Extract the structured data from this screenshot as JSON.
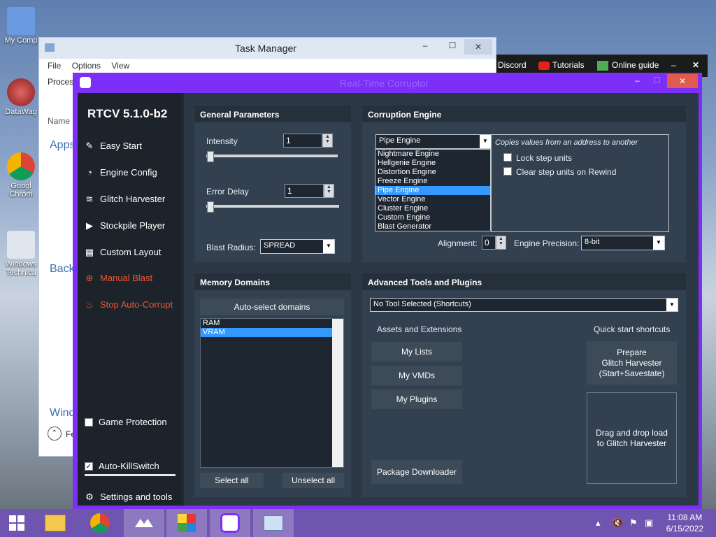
{
  "desktop": {
    "icons": [
      {
        "label": "My Comp",
        "color": "#6a9be0"
      },
      {
        "label": "DataWag",
        "color": "#d9534f"
      },
      {
        "label": "Googl Chrom",
        "color": "#4285f4"
      },
      {
        "label": "Windows Technica",
        "color": "#8ba3c4"
      }
    ]
  },
  "black_strip": {
    "discord": "Discord",
    "tutorials": "Tutorials",
    "online_guide": "Online guide",
    "close": "✕",
    "minimize": "–"
  },
  "task_manager": {
    "title": "Task Manager",
    "menu": [
      "File",
      "Options",
      "View"
    ],
    "tab_processes": "Proces",
    "col_name": "Name",
    "group_apps": "Apps",
    "group_background": "Back",
    "group_windows": "Wind",
    "fewer": "Fe"
  },
  "rtc": {
    "title": "Real-Time Corruptor",
    "version": "RTCV 5.1.0-b2",
    "sidebar": {
      "easy_start": "Easy Start",
      "engine_config": "Engine Config",
      "glitch_harvester": "Glitch Harvester",
      "stockpile_player": "Stockpile Player",
      "custom_layout": "Custom Layout",
      "manual_blast": "Manual Blast",
      "stop_auto_corrupt": "Stop Auto-Corrupt",
      "game_protection": "Game Protection",
      "auto_killswitch": "Auto-KillSwitch",
      "settings_tools": "Settings and tools"
    },
    "general_params": {
      "header": "General Parameters",
      "intensity_label": "Intensity",
      "intensity_value": "1",
      "error_delay_label": "Error Delay",
      "error_delay_value": "1",
      "blast_radius_label": "Blast Radius:",
      "blast_radius_value": "SPREAD"
    },
    "corruption_engine": {
      "header": "Corruption Engine",
      "selected": "Pipe Engine",
      "description": "Copies values from an address to another",
      "options": [
        "Nightmare Engine",
        "Hellgenie Engine",
        "Distortion Engine",
        "Freeze Engine",
        "Pipe Engine",
        "Vector Engine",
        "Cluster Engine",
        "Custom Engine",
        "Blast Generator"
      ],
      "selected_index": 4,
      "lock_step": "Lock step units",
      "clear_step": "Clear step units on Rewind",
      "alignment_label": "Alignment:",
      "alignment_value": "0",
      "precision_label": "Engine Precision:",
      "precision_value": "8-bit"
    },
    "memory_domains": {
      "header": "Memory Domains",
      "auto_select": "Auto-select domains",
      "items": [
        "RAM",
        "VRAM"
      ],
      "selected_index": 1,
      "select_all": "Select all",
      "unselect_all": "Unselect all"
    },
    "advanced": {
      "header": "Advanced Tools and Plugins",
      "tool_select": "No Tool Selected (Shortcuts)",
      "assets_header": "Assets and Extensions",
      "my_lists": "My Lists",
      "my_vmds": "My VMDs",
      "my_plugins": "My Plugins",
      "package_downloader": "Package Downloader",
      "quick_header": "Quick start shortcuts",
      "prepare_line1": "Prepare",
      "prepare_line2": "Glitch Harvester",
      "prepare_line3": "(Start+Savestate)",
      "drag_drop_line1": "Drag and drop load",
      "drag_drop_line2": "to Glitch Harvester"
    }
  },
  "taskbar": {
    "time": "11:08 AM",
    "date": "6/15/2022"
  }
}
